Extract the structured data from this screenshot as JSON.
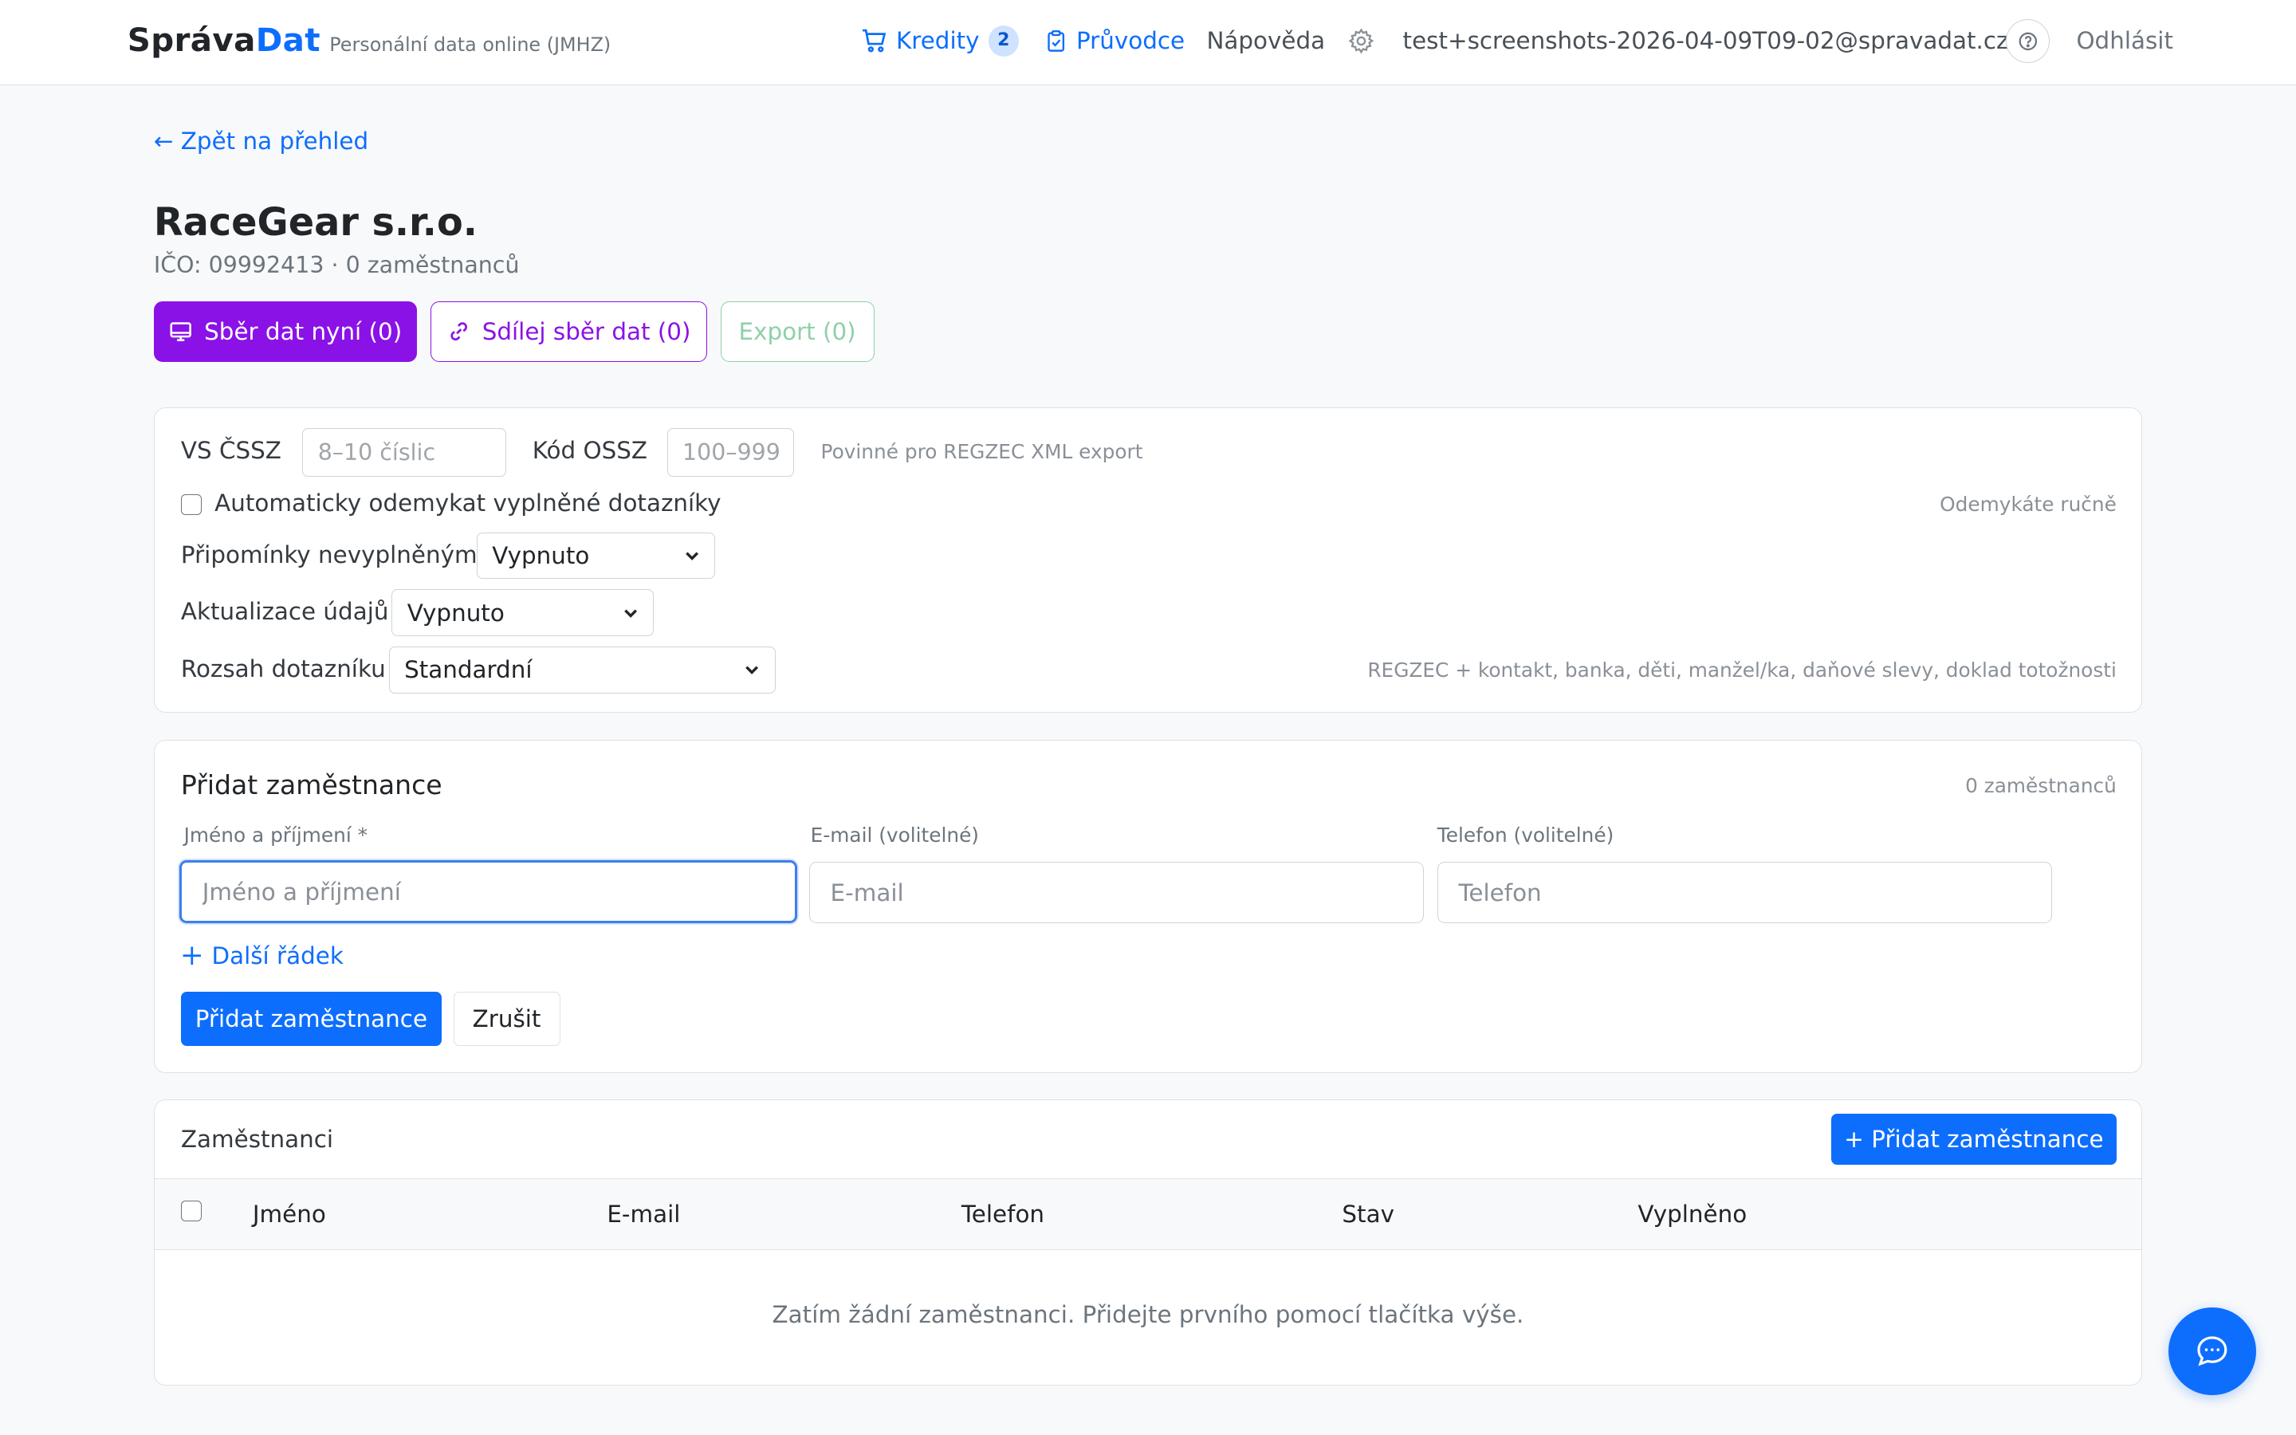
{
  "header": {
    "brand_part1": "Správa",
    "brand_part2": "Dat",
    "brand_sub": "Personální data online (JMHZ)",
    "credits_label": "Kredity",
    "credits_count": "2",
    "guide_label": "Průvodce",
    "help_label": "Nápověda",
    "user_email": "test+screenshots-2026-04-09T09-02@spravadat.cz",
    "logout_label": "Odhlásit"
  },
  "page": {
    "back_link": "← Zpět na přehled",
    "company_name": "RaceGear s.r.o.",
    "company_meta": "IČO: 09992413 · 0 zaměstnanců"
  },
  "actions": {
    "collect_now": "Sběr dat nyní (0)",
    "share_collect": "Sdílej sběr dat (0)",
    "export": "Export (0)"
  },
  "settings": {
    "vs_label": "VS ČSSZ",
    "vs_placeholder": "8–10 číslic",
    "ossz_label": "Kód OSSZ",
    "ossz_placeholder": "100–999",
    "regzec_hint": "Povinné pro REGZEC XML export",
    "auto_unlock_label": "Automaticky odemykat vyplněné dotazníky",
    "auto_unlock_status": "Odemykáte ručně",
    "reminders_label": "Připomínky nevyplněným",
    "reminders_value": "Vypnuto",
    "updates_label": "Aktualizace údajů",
    "updates_value": "Vypnuto",
    "scope_label": "Rozsah dotazníku",
    "scope_value": "Standardní",
    "scope_hint": "REGZEC + kontakt, banka, děti, manžel/ka, daňové slevy, doklad totožnosti"
  },
  "add_employee": {
    "title": "Přidat zaměstnance",
    "count": "0 zaměstnanců",
    "name_label": "Jméno a příjmení *",
    "name_placeholder": "Jméno a příjmení",
    "email_label": "E-mail (volitelné)",
    "email_placeholder": "E-mail",
    "phone_label": "Telefon (volitelné)",
    "phone_placeholder": "Telefon",
    "next_row": "Další řádek",
    "submit": "Přidat zaměstnance",
    "cancel": "Zrušit"
  },
  "employees": {
    "title": "Zaměstnanci",
    "add_button": "+ Přidat zaměstnance",
    "columns": [
      "Jméno",
      "E-mail",
      "Telefon",
      "Stav",
      "Vyplněno"
    ],
    "empty_message": "Zatím žádní zaměstnanci. Přidejte prvního pomocí tlačítka výše."
  },
  "colors": {
    "primary": "#0d6efd",
    "purple": "#8b12e6",
    "export_green": "#8fd0a8"
  },
  "icons": {
    "credits": "cart-icon",
    "guide": "clipboard-check-icon",
    "settings": "gear-icon",
    "help": "question-circle-icon",
    "collect": "monitor-icon",
    "share": "link-icon",
    "next_row": "plus-icon",
    "chat": "chat-bubble-icon"
  }
}
